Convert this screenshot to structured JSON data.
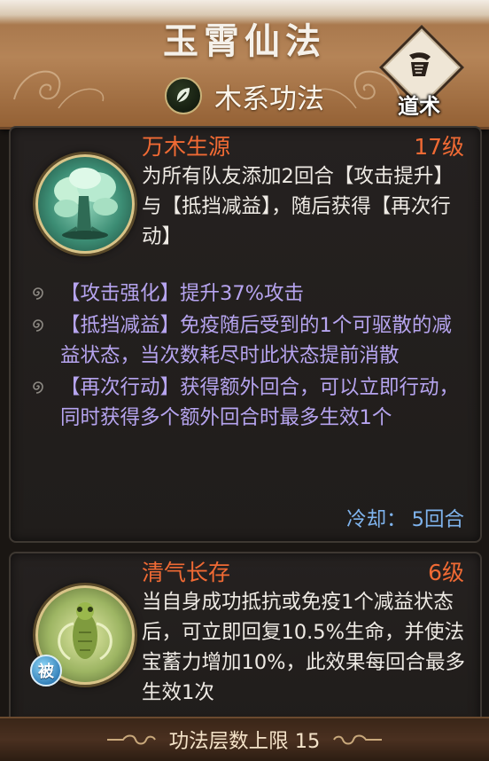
{
  "header": {
    "title": "玉霄仙法",
    "school_label": "木系功法",
    "school_icon": "leaf-icon",
    "daoshu_label": "道术",
    "daoshu_icon": "scroll-emblem-icon",
    "colors": {
      "banner": "#a87a4e",
      "title": "#f5f1ea"
    }
  },
  "skills": [
    {
      "name": "万木生源",
      "level": "17级",
      "icon": "great-tree-icon",
      "description": "为所有队友添加2回合【攻击提升】与【抵挡减益】，随后获得【再次行动】",
      "effects": [
        "【攻击强化】提升37%攻击",
        "【抵挡减益】免疫随后受到的1个可驱散的减益状态，当次数耗尽时此状态提前消散",
        "【再次行动】获得额外回合，可以立即行动，同时获得多个额外回合时最多生效1个"
      ],
      "cooldown_label": "冷却：",
      "cooldown_value": "5回合"
    },
    {
      "name": "清气长存",
      "level": "6级",
      "icon": "cicada-icon",
      "passive_badge": "被",
      "description": "当自身成功抵抗或免疫1个减益状态后，可立即回复10.5%生命，并使法宝蓄力增加10%，此效果每回合最多生效1次"
    }
  ],
  "footer": {
    "label": "功法层数上限 15"
  },
  "colors": {
    "skill_name": "#f06a34",
    "effect_text": "#b6a4ef",
    "cooldown": "#7fb4ee",
    "panel_bg": "#221e1c"
  }
}
